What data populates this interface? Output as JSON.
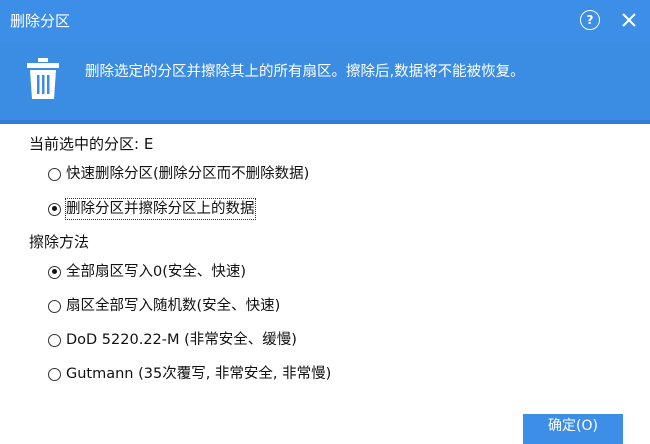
{
  "window": {
    "title": "删除分区",
    "help_label": "?",
    "colors": {
      "header": "#3c8ee6",
      "banner": "#3b8de4",
      "accent_line": "#2f7fd8"
    }
  },
  "banner": {
    "icon": "trash-icon",
    "text": "删除选定的分区并擦除其上的所有扇区。擦除后,数据将不能被恢复。"
  },
  "partition": {
    "label": "当前选中的分区: E",
    "options": [
      {
        "label": "快速删除分区(删除分区而不删除数据)",
        "checked": false
      },
      {
        "label": "删除分区并擦除分区上的数据",
        "checked": true
      }
    ]
  },
  "wipe": {
    "label": "擦除方法",
    "options": [
      {
        "label": "全部扇区写入0(安全、快速)",
        "checked": true
      },
      {
        "label": "扇区全部写入随机数(安全、快速)",
        "checked": false
      },
      {
        "label": "DoD 5220.22-M (非常安全、缓慢)",
        "checked": false
      },
      {
        "label": "Gutmann (35次覆写, 非常安全, 非常慢)",
        "checked": false
      }
    ]
  },
  "footer": {
    "confirm_label": "确定(O)"
  }
}
